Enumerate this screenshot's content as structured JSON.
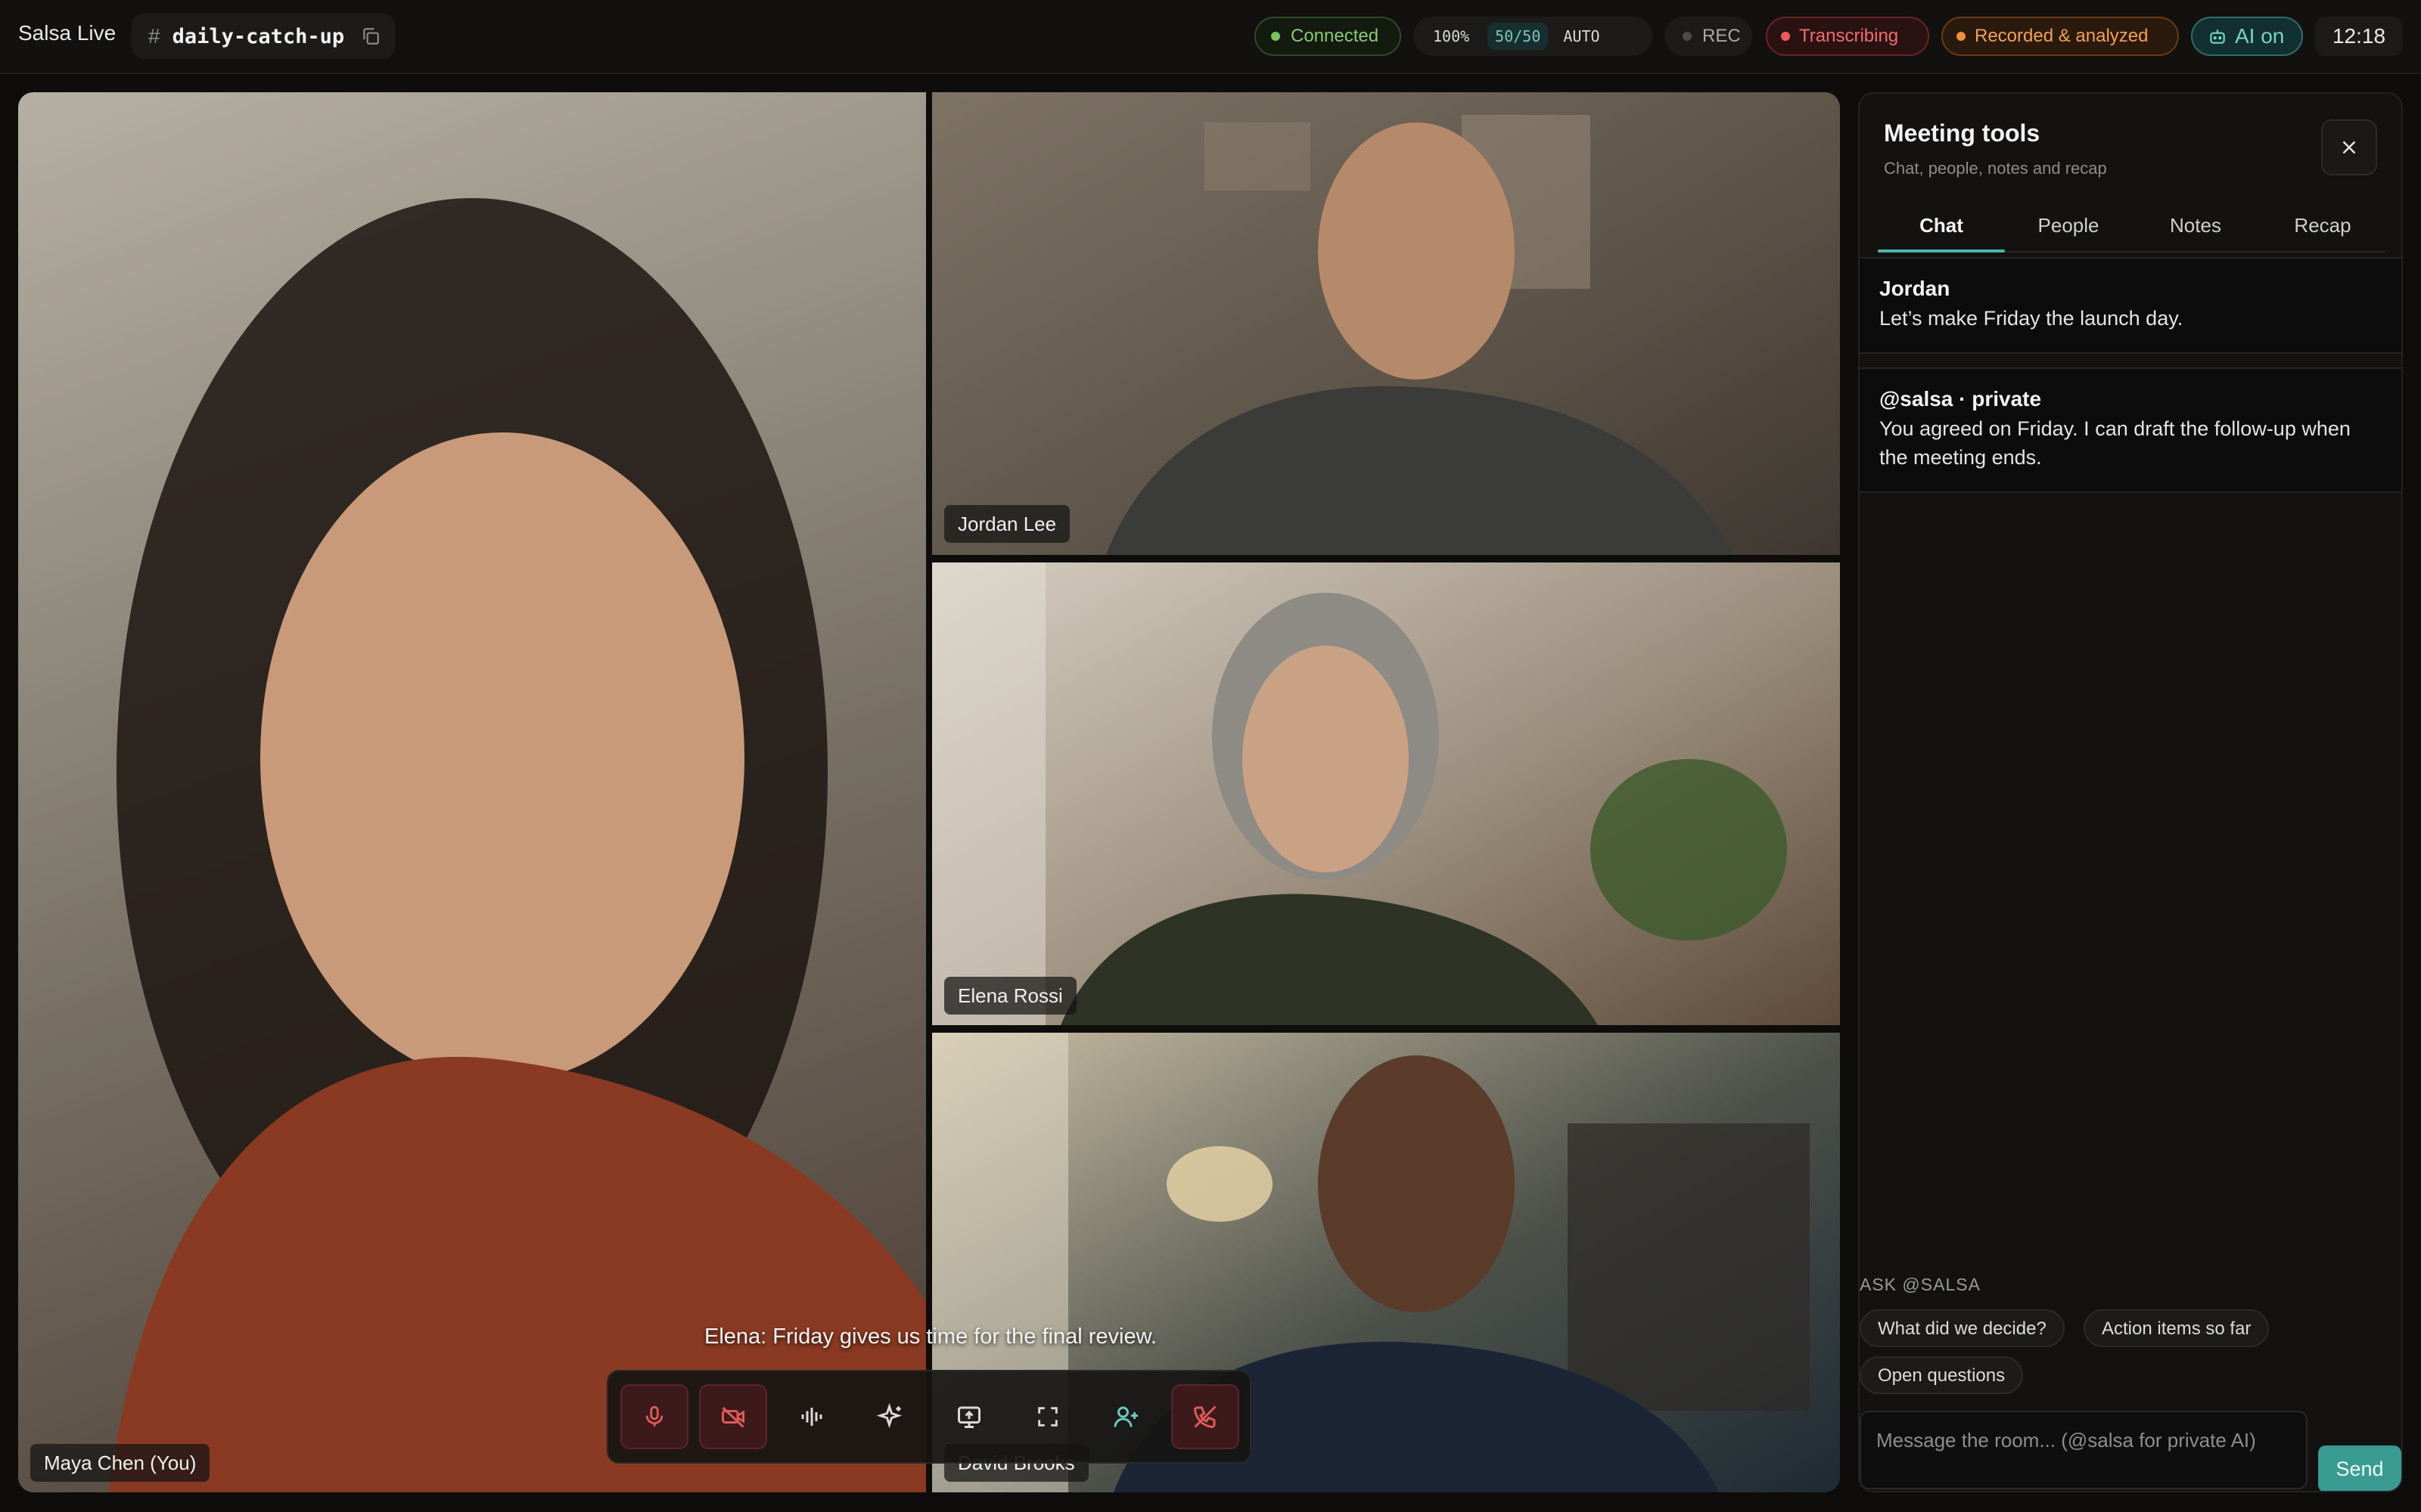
{
  "app": {
    "name": "Salsa Live",
    "channel": "daily-catch-up",
    "channel_prefix": "#"
  },
  "status": {
    "connected": "Connected",
    "quality": "100%",
    "participants": "50/50",
    "mode": "AUTO",
    "rec": "REC",
    "transcribing": "Transcribing",
    "recorded": "Recorded & analyzed",
    "ai": "AI on",
    "time": "12:18"
  },
  "participants": [
    {
      "name": "Maya Chen (You)"
    },
    {
      "name": "Jordan Lee"
    },
    {
      "name": "Elena Rossi"
    },
    {
      "name": "David Brooks"
    }
  ],
  "caption": "Elena: Friday gives us time for the final review.",
  "controls": [
    {
      "icon": "microphone-muted-icon"
    },
    {
      "icon": "camera-off-icon"
    },
    {
      "icon": "audio-waveform-icon"
    },
    {
      "icon": "ai-sparkle-icon"
    },
    {
      "icon": "screen-share-icon"
    },
    {
      "icon": "fullscreen-icon"
    },
    {
      "icon": "add-person-icon"
    },
    {
      "icon": "end-call-icon"
    }
  ],
  "panel": {
    "title": "Meeting tools",
    "subtitle": "Chat, people, notes and recap",
    "tabs": [
      "Chat",
      "People",
      "Notes",
      "Recap"
    ],
    "active_tab": "Chat",
    "messages": [
      {
        "author": "Jordan",
        "text": "Let’s make Friday the launch day."
      },
      {
        "author": "@salsa · private",
        "text": "You agreed on Friday. I can draft the follow-up when the meeting ends."
      }
    ],
    "ask_label": "ASK @SALSA",
    "suggestions": [
      "What did we decide?",
      "Action items so far",
      "Open questions"
    ],
    "input_placeholder": "Message the room... (@salsa for private AI)",
    "send_label": "Send"
  },
  "colors": {
    "accent": "#3a9b92",
    "connected": "#8bc872",
    "recording": "#f06c6c",
    "recorded": "#f2a059",
    "ai": "#79d1c8"
  }
}
